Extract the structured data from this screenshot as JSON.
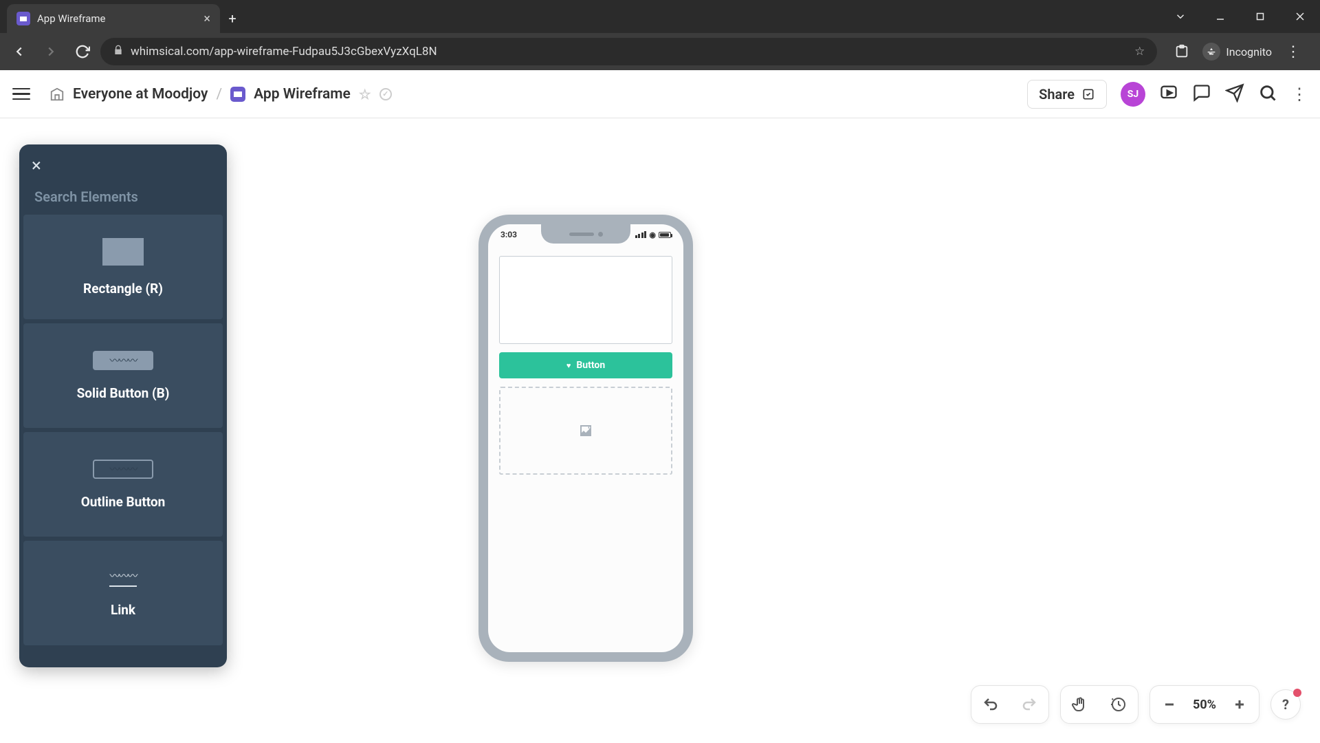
{
  "browser": {
    "tab_title": "App Wireframe",
    "url": "whimsical.com/app-wireframe-Fudpau5J3cGbexVyzXqL8N",
    "incognito_label": "Incognito"
  },
  "header": {
    "workspace": "Everyone at Moodjoy",
    "doc_title": "App Wireframe",
    "share_label": "Share",
    "avatar_initials": "SJ"
  },
  "panel": {
    "search_placeholder": "Search Elements",
    "items": [
      {
        "label": "Rectangle (R)"
      },
      {
        "label": "Solid Button (B)"
      },
      {
        "label": "Outline Button"
      },
      {
        "label": "Link"
      }
    ]
  },
  "phone": {
    "time": "3:03",
    "button_label": "Button"
  },
  "toolbar": {
    "zoom": "50%"
  }
}
